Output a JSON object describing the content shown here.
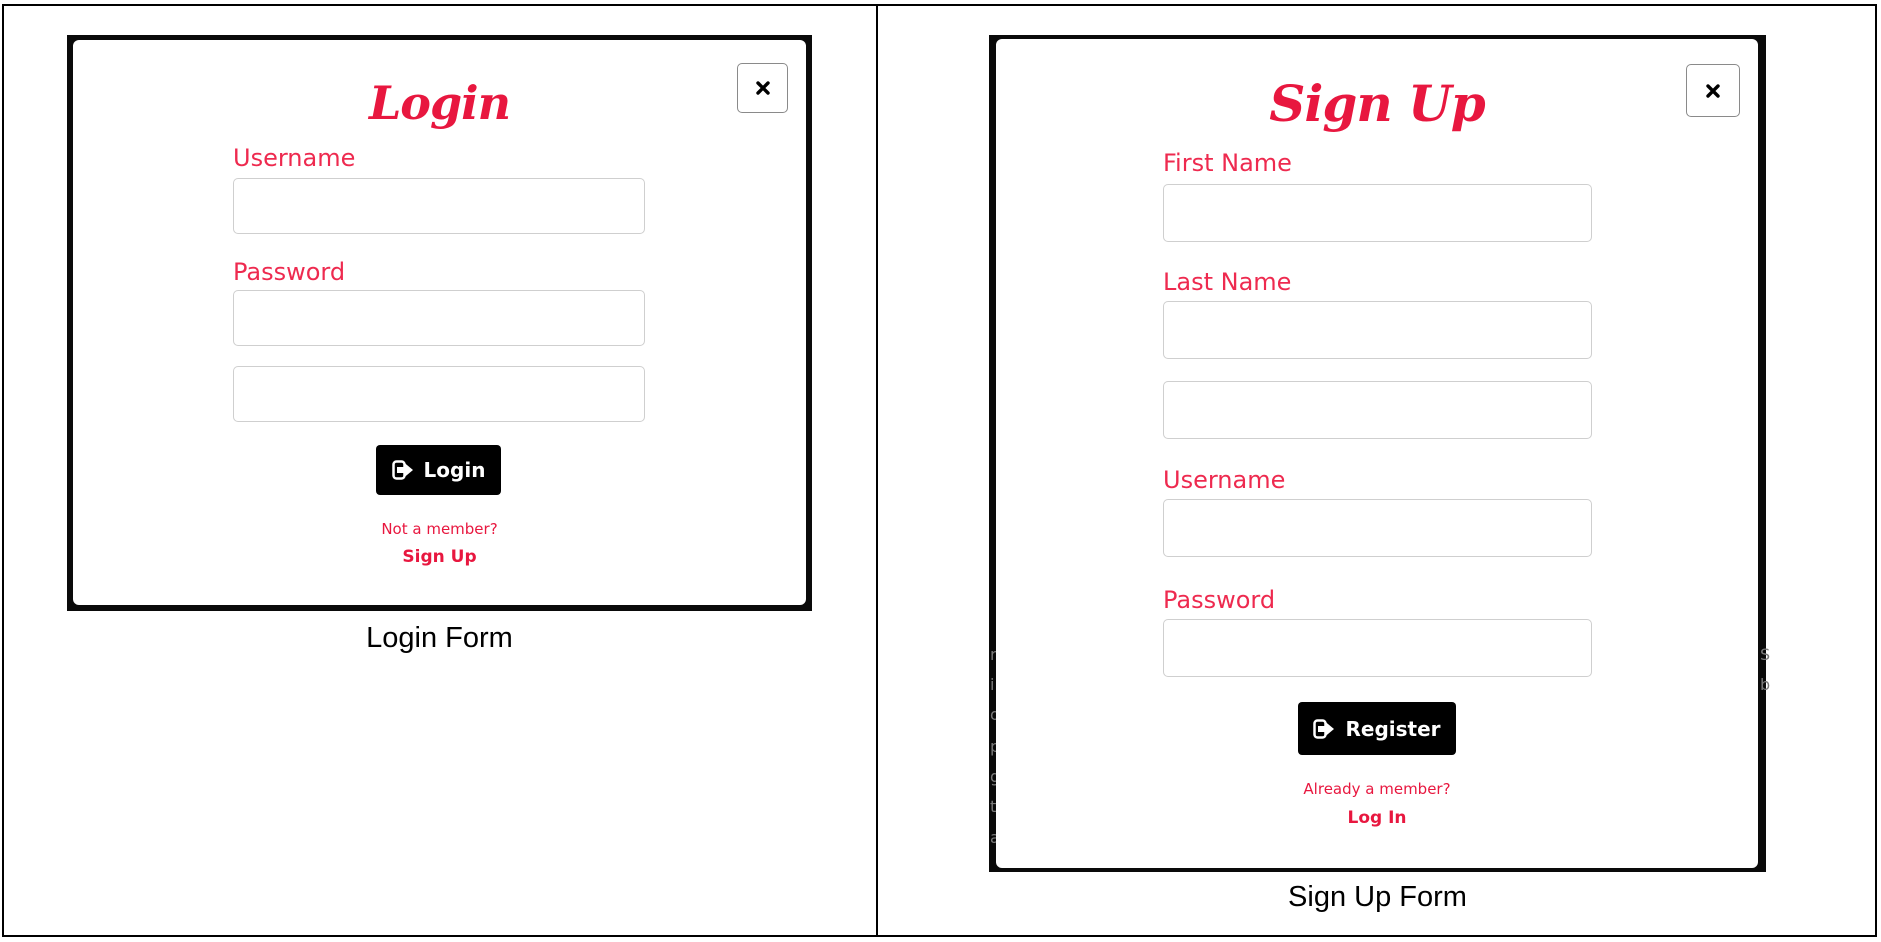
{
  "login": {
    "title": "Login",
    "fields": [
      {
        "label": "Username",
        "value": "",
        "placeholder": ""
      },
      {
        "label": "Password",
        "value": "",
        "placeholder": ""
      },
      {
        "label": "",
        "value": "",
        "placeholder": ""
      }
    ],
    "button_label": "Login",
    "button_icon": "sign-in-icon",
    "prompt": "Not a member?",
    "link": "Sign Up",
    "caption": "Login Form"
  },
  "signup": {
    "title": "Sign Up",
    "fields": [
      {
        "label": "First Name",
        "value": "",
        "placeholder": ""
      },
      {
        "label": "Last Name",
        "value": "",
        "placeholder": ""
      },
      {
        "label": "",
        "value": "",
        "placeholder": ""
      },
      {
        "label": "Username",
        "value": "",
        "placeholder": ""
      },
      {
        "label": "Password",
        "value": "",
        "placeholder": ""
      }
    ],
    "button_label": "Register",
    "button_icon": "sign-in-icon",
    "prompt": "Already a member?",
    "link": "Log In",
    "caption": "Sign Up Form"
  },
  "close_icon": "close-icon",
  "colors": {
    "accent": "#e8173f",
    "label": "#ee2a4f",
    "button_bg": "#000000",
    "overlay": "#0a0a0a",
    "field_border": "#cfcfcf"
  }
}
